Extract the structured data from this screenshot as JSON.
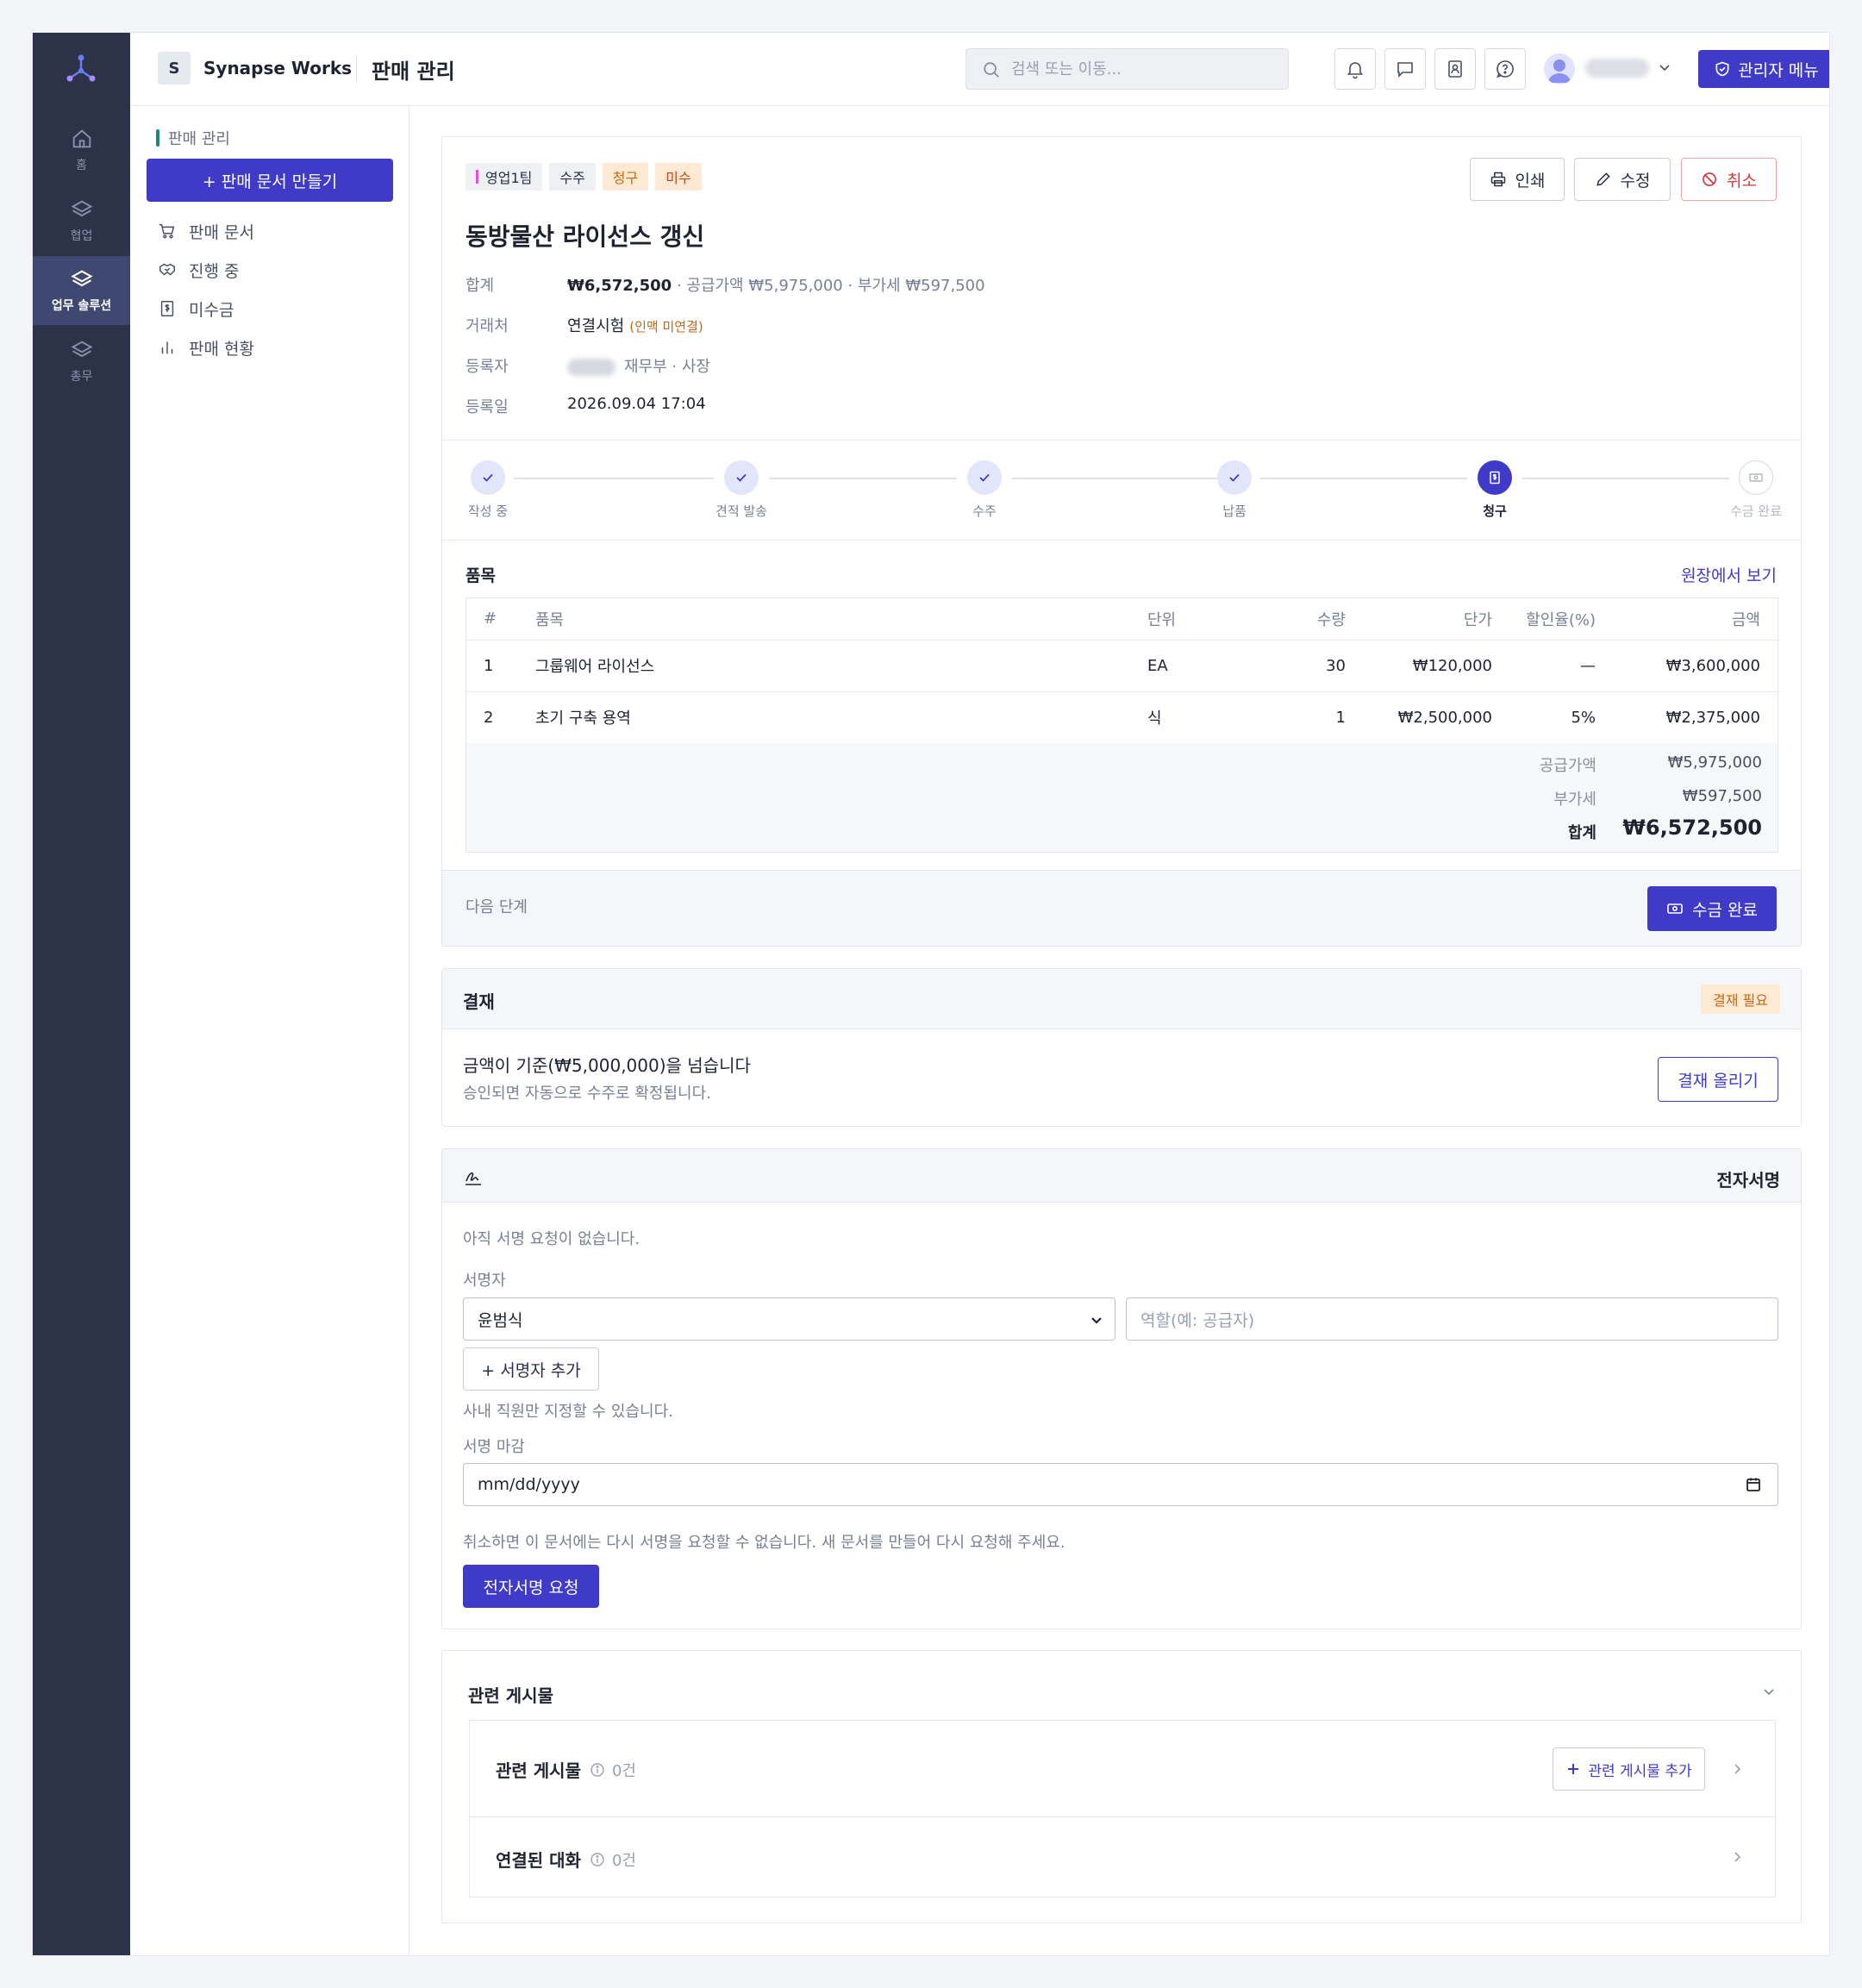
{
  "topbar": {
    "workspace_initial": "S",
    "workspace_name": "Synapse Works",
    "page_title": "판매 관리",
    "search_placeholder": "검색 또는 이동...",
    "admin_label": "관리자 메뉴"
  },
  "rail": {
    "items": [
      {
        "label": "홈"
      },
      {
        "label": "협업"
      },
      {
        "label": "업무 솔루션"
      },
      {
        "label": "총무"
      }
    ]
  },
  "sidebar": {
    "section": "판매 관리",
    "create_label": "+ 판매 문서 만들기",
    "items": [
      {
        "label": "판매 문서"
      },
      {
        "label": "진행 중"
      },
      {
        "label": "미수금"
      },
      {
        "label": "판매 현황"
      }
    ]
  },
  "doc": {
    "tags": [
      "영업1팀",
      "수주",
      "청구",
      "미수"
    ],
    "actions": {
      "print": "인쇄",
      "edit": "수정",
      "cancel": "취소"
    },
    "title": "동방물산 라이선스 갱신",
    "meta": {
      "total_label": "합계",
      "total_value": "₩6,572,500",
      "total_detail": "· 공급가액 ₩5,975,000 · 부가세 ₩597,500",
      "client_label": "거래처",
      "client_value": "연결시험",
      "client_note": "(인맥 미연결)",
      "registrant_label": "등록자",
      "registrant_value": "재무부 · 사장",
      "date_label": "등록일",
      "date_value": "2026.09.04 17:04"
    },
    "steps": [
      "작성 중",
      "견적 발송",
      "수주",
      "납품",
      "청구",
      "수금 완료"
    ],
    "current_step": 4
  },
  "items_section": {
    "title": "품목",
    "ledger_link": "원장에서 보기",
    "columns": [
      "#",
      "품목",
      "단위",
      "수량",
      "단가",
      "할인율(%)",
      "금액"
    ],
    "rows": [
      {
        "no": "1",
        "name": "그룹웨어 라이선스",
        "unit": "EA",
        "qty": "30",
        "price": "₩120,000",
        "discount": "—",
        "amount": "₩3,600,000"
      },
      {
        "no": "2",
        "name": "초기 구축 용역",
        "unit": "식",
        "qty": "1",
        "price": "₩2,500,000",
        "discount": "5%",
        "amount": "₩2,375,000"
      }
    ],
    "supply_label": "공급가액",
    "supply_value": "₩5,975,000",
    "vat_label": "부가세",
    "vat_value": "₩597,500",
    "total_label": "합계",
    "total_value": "₩6,572,500",
    "next_label": "다음 단계",
    "next_button": "수금 완료"
  },
  "approval": {
    "title": "결재",
    "badge": "결재 필요",
    "message": "금액이 기준(₩5,000,000)을 넘습니다",
    "sub": "승인되면 자동으로 수주로 확정됩니다.",
    "button": "결재 올리기"
  },
  "esign": {
    "title": "전자서명",
    "empty": "아직 서명 요청이 없습니다.",
    "signer_label": "서명자",
    "signer_value": "윤범식",
    "role_placeholder": "역할(예: 공급자)",
    "add_signer": "+ 서명자 추가",
    "staff_hint": "사내 직원만 지정할 수 있습니다.",
    "deadline_label": "서명 마감",
    "deadline_placeholder": "mm/dd/yyyy",
    "cancel_hint": "취소하면 이 문서에는 다시 서명을 요청할 수 없습니다. 새 문서를 만들어 다시 요청해 주세요.",
    "request_button": "전자서명 요청"
  },
  "related": {
    "title": "관련 게시물",
    "posts_title": "관련 게시물",
    "posts_count": "0건",
    "add_post": "관련 게시물 추가",
    "chats_title": "연결된 대화",
    "chats_count": "0건"
  },
  "colors": {
    "accent": "#3f3bc8",
    "rail": "#2c3248",
    "warn": "#c36a16",
    "danger": "#d63a3a"
  }
}
